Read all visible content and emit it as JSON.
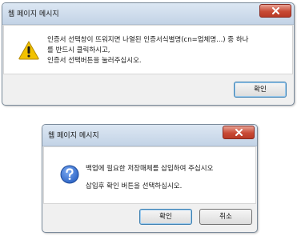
{
  "dialog1": {
    "title": "웹 페이지 메시지",
    "icon": "warning-icon",
    "lines": [
      "인증서 선택창이 뜨워지면 나열된 인증서식별명(cn=업체명...) 중 하나",
      "를  반드시 클릭하시고,",
      "인증서 선택버튼을 눌러주십시오."
    ],
    "ok_label": "확인"
  },
  "dialog2": {
    "title": "웹 페이지 메시지",
    "icon": "question-icon",
    "lines": [
      "백업에 필요한 저장매체를 삽입하여 주십시오",
      "삽입후 확인 버튼을 선택하십시오."
    ],
    "ok_label": "확인",
    "cancel_label": "취소"
  },
  "colors": {
    "warning": "#f2c200",
    "question": "#2a62c4",
    "close": "#c84a35"
  }
}
